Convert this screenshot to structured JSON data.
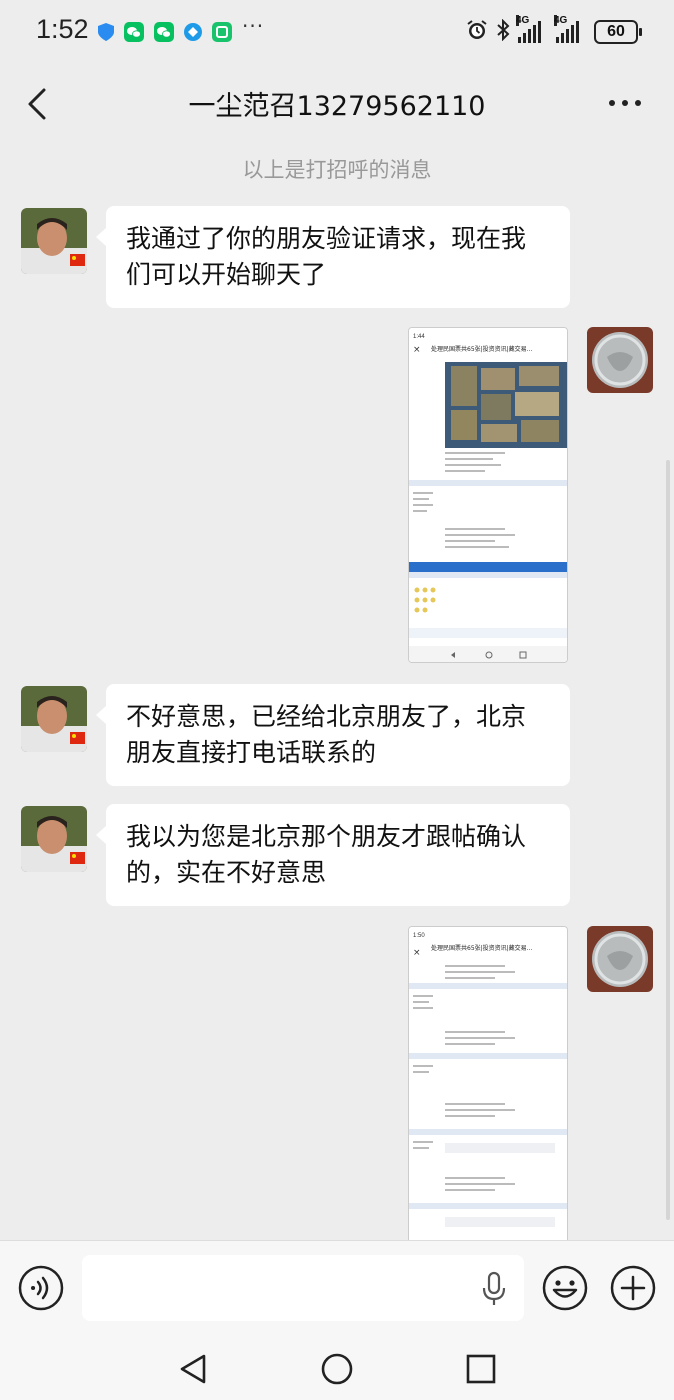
{
  "status_bar": {
    "time": "1:52",
    "network_1": "4G",
    "network_2": "4G",
    "battery": "60",
    "overflow": "···"
  },
  "header": {
    "title": "一尘范召13279562110"
  },
  "system_message": "以上是打招呼的消息",
  "messages": [
    {
      "text": "我通过了你的朋友验证请求，现在我们可以开始聊天了"
    },
    {
      "text": "不好意思，已经给北京朋友了，北京朋友直接打电话联系的"
    },
    {
      "text": "我以为您是北京那个朋友才跟帖确认的，实在不好意思"
    }
  ],
  "screenshots": [
    {
      "time": "1:44",
      "title": "处理民国票共65张|投资资讯|藏交易..."
    },
    {
      "time": "1:50",
      "title": "处理民国票共65张|投资资讯|藏交易..."
    }
  ],
  "input": {
    "value": ""
  },
  "icons": {
    "back": "back-arrow-icon",
    "more": "more-icon",
    "voice": "voice-icon",
    "mic": "microphone-icon",
    "emoji": "emoji-icon",
    "plus": "plus-icon",
    "nav_back": "triangle-back-icon",
    "nav_home": "circle-home-icon",
    "nav_recent": "square-recents-icon"
  },
  "colors": {
    "background": "#ededed",
    "bubble": "#ffffff",
    "wechat_green": "#07c160"
  }
}
